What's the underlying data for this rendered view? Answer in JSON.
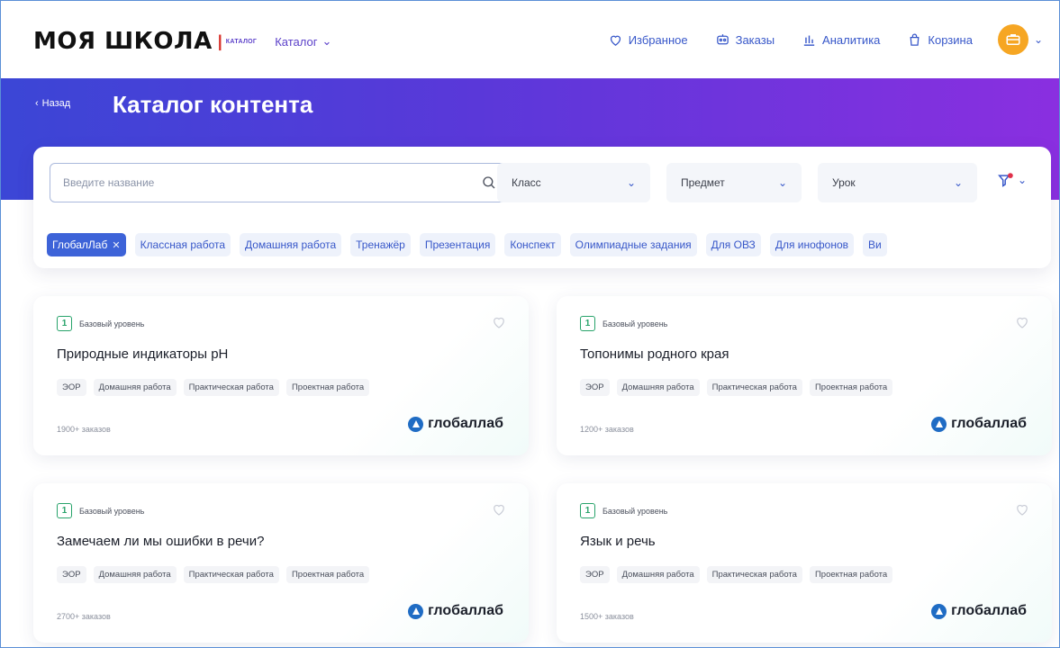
{
  "header": {
    "logo": "МОЯ ШКОЛА",
    "logo_sub": "каталог",
    "catalog_menu": "Каталог",
    "nav": [
      {
        "label": "Избранное",
        "icon": "heart-icon"
      },
      {
        "label": "Заказы",
        "icon": "orders-icon"
      },
      {
        "label": "Аналитика",
        "icon": "analytics-icon"
      },
      {
        "label": "Корзина",
        "icon": "cart-icon"
      }
    ]
  },
  "hero": {
    "back_label": "Назад",
    "title": "Каталог контента"
  },
  "filters": {
    "search_placeholder": "Введите название",
    "class_label": "Класс",
    "subject_label": "Предмет",
    "lesson_label": "Урок",
    "chips": [
      {
        "label": "ГлобалЛаб",
        "active": true
      },
      {
        "label": "Классная работа",
        "active": false
      },
      {
        "label": "Домашняя работа",
        "active": false
      },
      {
        "label": "Тренажёр",
        "active": false
      },
      {
        "label": "Презентация",
        "active": false
      },
      {
        "label": "Конспект",
        "active": false
      },
      {
        "label": "Олимпиадные задания",
        "active": false
      },
      {
        "label": "Для ОВЗ",
        "active": false
      },
      {
        "label": "Для инофонов",
        "active": false
      },
      {
        "label": "Ви",
        "active": false
      }
    ]
  },
  "cards": [
    {
      "level_num": "1",
      "level": "Базовый уровень",
      "title": "Природные индикаторы pH",
      "tags": [
        "ЭОР",
        "Домашняя работа",
        "Практическая работа",
        "Проектная работа"
      ],
      "orders": "1900+ заказов",
      "provider": "глобаллаб"
    },
    {
      "level_num": "1",
      "level": "Базовый уровень",
      "title": "Топонимы родного края",
      "tags": [
        "ЭОР",
        "Домашняя работа",
        "Практическая работа",
        "Проектная работа"
      ],
      "orders": "1200+ заказов",
      "provider": "глобаллаб"
    },
    {
      "level_num": "1",
      "level": "Базовый уровень",
      "title": "Замечаем ли мы ошибки в речи?",
      "tags": [
        "ЭОР",
        "Домашняя работа",
        "Практическая работа",
        "Проектная работа"
      ],
      "orders": "2700+ заказов",
      "provider": "глобаллаб"
    },
    {
      "level_num": "1",
      "level": "Базовый уровень",
      "title": "Язык и речь",
      "tags": [
        "ЭОР",
        "Домашняя работа",
        "Практическая работа",
        "Проектная работа"
      ],
      "orders": "1500+ заказов",
      "provider": "глобаллаб"
    }
  ],
  "colors": {
    "accent": "#3757c9",
    "hero_start": "#3b46d6",
    "hero_end": "#8a2fe0",
    "level_green": "#27a36a",
    "avatar": "#f6a623"
  }
}
